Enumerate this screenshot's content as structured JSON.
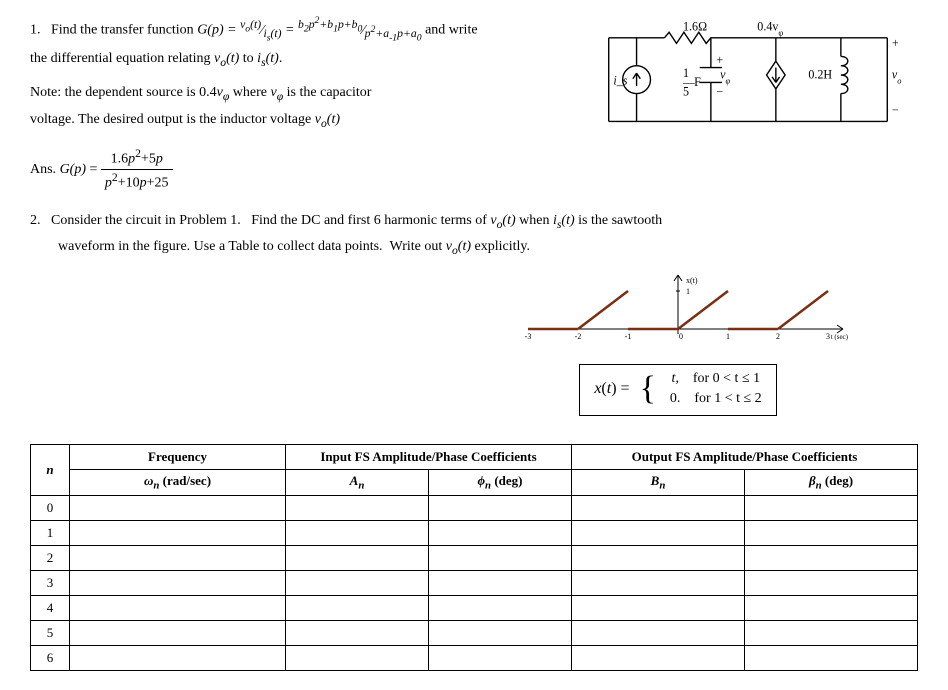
{
  "p1": {
    "line1_a": "1.   Find the transfer function ",
    "eq1": "G(p) = v_o(t)⁄i_s(t) = (b₂p²+b₁p+b₀)⁄(p²+a₋₁p+a₀)",
    "line1_b": " and write",
    "line2": "the differential equation relating v_o(t) to i_s(t).",
    "note1": "Note: the dependent source is 0.4v_ϕ where v_ϕ is the capacitor",
    "note2": "voltage. The desired output is the inductor voltage v_o(t)",
    "ans": "Ans. G(p) = (1.6p²+5p)⁄(p²+10p+25)"
  },
  "circuit": {
    "r": "1.6Ω",
    "src": "i_s",
    "c": "1/5 F",
    "vphi": "v_ϕ",
    "dep": "0.4v_ϕ",
    "l": "0.2H",
    "vo": "v_o",
    "plus": "+",
    "minus": "−"
  },
  "p2": {
    "line1": "2.   Consider the circuit in Problem 1.   Find the DC and first 6 harmonic terms of v_o(t) when i_s(t) is the sawtooth",
    "line2": "waveform in the figure. Use a Table to collect the data points.  Write out v_o(t) explicitly."
  },
  "sawtooth": {
    "ylabel": "x(t)",
    "xlabel": "t (sec)",
    "ticks_x": [
      "-3",
      "-2",
      "-1",
      "0",
      "1",
      "2",
      "3"
    ],
    "ymax": "1"
  },
  "piecewise": {
    "lhs": "x(t) = ",
    "r1_l": "t,",
    "r1_r": "for 0 < t ≤ 1",
    "r2_l": "0.",
    "r2_r": "for 1 < t ≤ 2"
  },
  "table": {
    "h_n": "n",
    "h_freq": "Frequency",
    "h_wn": "ωₙ (rad/sec)",
    "h_in": "Input FS Amplitude/Phase Coefficients",
    "h_An": "Aₙ",
    "h_phin": "ϕₙ (deg)",
    "h_out": "Output FS Amplitude/Phase Coefficients",
    "h_Bn": "Bₙ",
    "h_ben": "βₙ (deg)",
    "rows": [
      "0",
      "1",
      "2",
      "3",
      "4",
      "5",
      "6"
    ]
  }
}
